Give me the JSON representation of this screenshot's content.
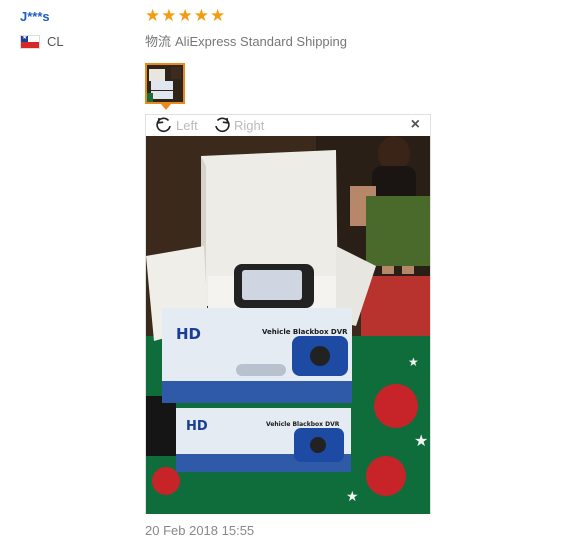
{
  "review": {
    "user_name": "J***s",
    "country_code": "CL",
    "rating_stars": 5,
    "shipping_label": "物流",
    "shipping_method": "AliExpress Standard Shipping",
    "date": "20 Feb 2018 15:55"
  },
  "viewer": {
    "rotate_left_label": "Left",
    "rotate_right_label": "Right",
    "close_symbol": "×"
  },
  "colors": {
    "user_name": "#1d5fc4",
    "star": "#f39c12",
    "thumb_border": "#e88a1c"
  }
}
